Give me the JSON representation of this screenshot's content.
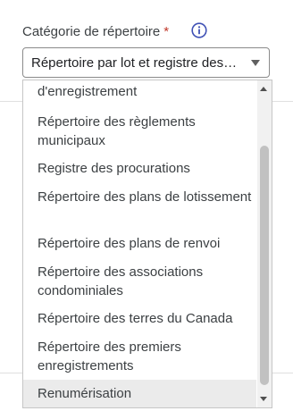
{
  "field": {
    "label": "Catégorie de répertoire",
    "required_mark": "*",
    "info_icon": "info-icon",
    "selected_value": "Répertoire par lot et registre des droits réels",
    "caret_icon": "chevron-down-icon"
  },
  "dropdown": {
    "options": [
      "d'enregistrement",
      "Répertoire des règlements municipaux",
      "Registre des procurations",
      "Répertoire des plans de lotissement",
      "Répertoire des plans de renvoi",
      "Répertoire des associations condominiales",
      "Répertoire des terres du Canada",
      "Répertoire des premiers enregistrements",
      "Renumérisation"
    ],
    "highlighted_option": "Renumérisation"
  },
  "colors": {
    "required": "#c0392b",
    "info_icon": "#3f51b5",
    "highlight": "#ebebeb",
    "scroll_thumb": "#c1c1c1"
  }
}
